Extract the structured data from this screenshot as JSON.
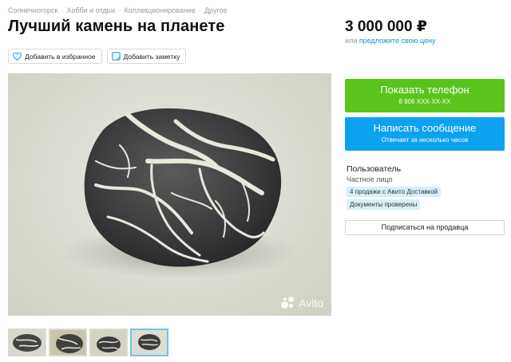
{
  "breadcrumb": [
    "Солнечногорск",
    "Хобби и отдых",
    "Коллекционирование",
    "Другое"
  ],
  "listing": {
    "title": "Лучший камень на планете",
    "price": "3 000 000 ₽",
    "price_or": "или ",
    "price_offer_link": "предложите свою цену"
  },
  "actions": {
    "favorite_label": "Добавить в избранное",
    "note_label": "Добавить заметку"
  },
  "photo": {
    "watermark": "Avito",
    "thumbnail_count": 4,
    "active_thumbnail": 4
  },
  "contact": {
    "phone_button": "Показать телефон",
    "phone_number": "8 906 XXX-XX-XX",
    "message_button": "Написать сообщение",
    "message_sub": "Отвечает за несколько часов"
  },
  "seller": {
    "name": "Пользователь",
    "type": "Частное лицо",
    "badges": [
      "4 продажи с Авито Доставкой",
      "Документы проверены"
    ],
    "subscribe_button": "Подписаться на продавца"
  },
  "colors": {
    "phone_button": "#5ac41c",
    "message_button": "#0ca2f0",
    "link": "#1b8fd2",
    "badge_bg": "#d9eefb"
  }
}
